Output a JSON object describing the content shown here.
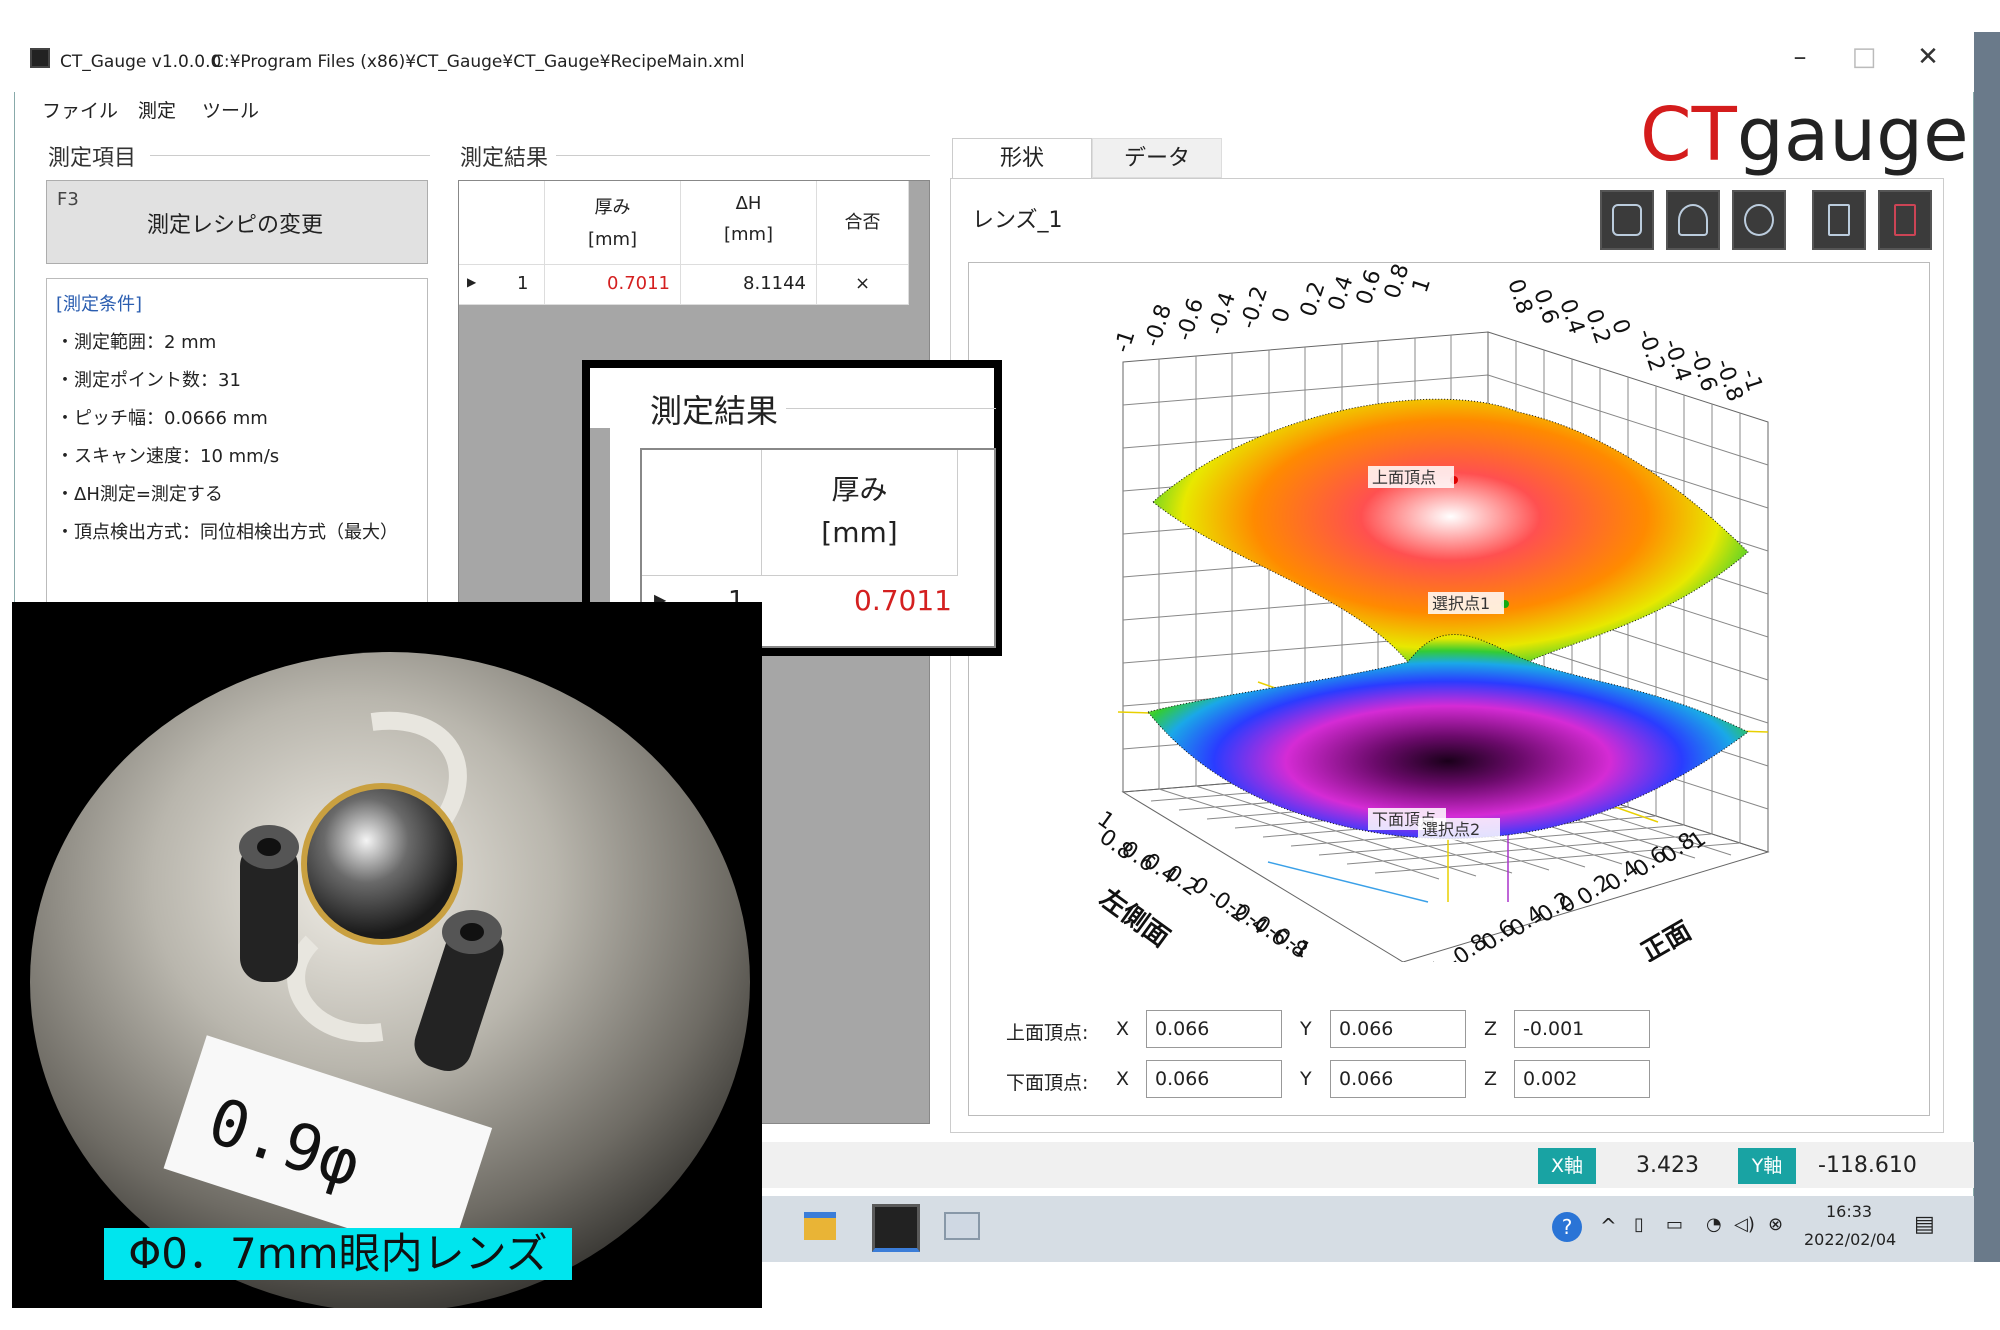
{
  "window": {
    "title": "CT_Gauge v1.0.0.0",
    "path": "C:¥Program Files (x86)¥CT_Gauge¥CT_Gauge¥RecipeMain.xml",
    "minimize": "–",
    "maximize": "□",
    "close": "✕"
  },
  "menu": [
    "ファイル",
    "測定",
    "ツール"
  ],
  "logo": {
    "ct": "CT",
    "gauge": "gauge",
    "ct_color": "#d41c1c",
    "gauge_color": "#222222"
  },
  "left": {
    "group_title": "測定項目",
    "recipe_key": "F3",
    "recipe_label": "測定レシピの変更",
    "conditions_title": "[測定条件]",
    "conditions": [
      "・測定範囲：2 mm",
      "・測定ポイント数：31",
      "・ピッチ幅：0.0666 mm",
      "・スキャン速度：10 mm/s",
      "・ΔH測定=測定する",
      "・頂点検出方式：同位相検出方式（最大）"
    ]
  },
  "results": {
    "group_title": "測定結果",
    "headers": {
      "thickness": "厚み",
      "dh": "ΔH",
      "unit": "[mm]",
      "pass": "合否"
    },
    "rows": [
      {
        "no": "1",
        "thickness": "0.7011",
        "dh": "8.1144",
        "pass": "×"
      }
    ]
  },
  "zoom": {
    "title": "測定結果",
    "header": "厚み",
    "unit": "[mm]",
    "row_no": "1",
    "value": "0.7011"
  },
  "tabs": {
    "shape": "形状",
    "data": "データ"
  },
  "lens_name": "レンズ_1",
  "toolbar_icons": [
    "view-3d-icon",
    "view-top-lens-icon",
    "view-circle-icon",
    "view-section-icon",
    "view-section-marker-icon"
  ],
  "plot": {
    "top_axis_ticks_left": [
      "-1",
      "-0.8",
      "-0.6",
      "-0.4",
      "-0.2",
      "0",
      "0.2",
      "0.4",
      "0.6",
      "0.8",
      "1"
    ],
    "top_axis_ticks_right": [
      "0.8",
      "0.6",
      "0.4",
      "0.2",
      "0",
      "-0.2",
      "-0.4",
      "-0.6",
      "-0.8",
      "-1"
    ],
    "bottom_left_ticks": [
      "1",
      "0.8",
      "0.6",
      "0.4",
      "0.2",
      "0",
      "-0.2",
      "-0.4",
      "-0.6",
      "-0.8",
      "-1"
    ],
    "bottom_right_ticks": [
      "-1",
      "-0.8",
      "-0.6",
      "-0.4",
      "-0.2",
      "0",
      "0.2",
      "0.4",
      "0.6",
      "0.8",
      "1"
    ],
    "label_left": "左側面",
    "label_right": "正面",
    "marker_top": "上面頂点",
    "marker_sel1": "選択点1",
    "marker_bottom": "下面頂点",
    "marker_sel2": "選択点2"
  },
  "coords": {
    "top_label": "上面頂点:",
    "bottom_label": "下面頂点:",
    "x": "X",
    "y": "Y",
    "z": "Z",
    "top": {
      "x": "0.066",
      "y": "0.066",
      "z": "-0.001"
    },
    "bottom": {
      "x": "0.066",
      "y": "0.066",
      "z": "0.002"
    }
  },
  "status": {
    "x_axis": "X軸",
    "x_value": "3.423",
    "y_axis": "Y軸",
    "y_value": "-118.610"
  },
  "taskbar": {
    "time": "16:33",
    "date": "2022/02/04"
  },
  "photo": {
    "label": "0.9φ",
    "caption": "Φ0．7mm眼内レンズ"
  }
}
